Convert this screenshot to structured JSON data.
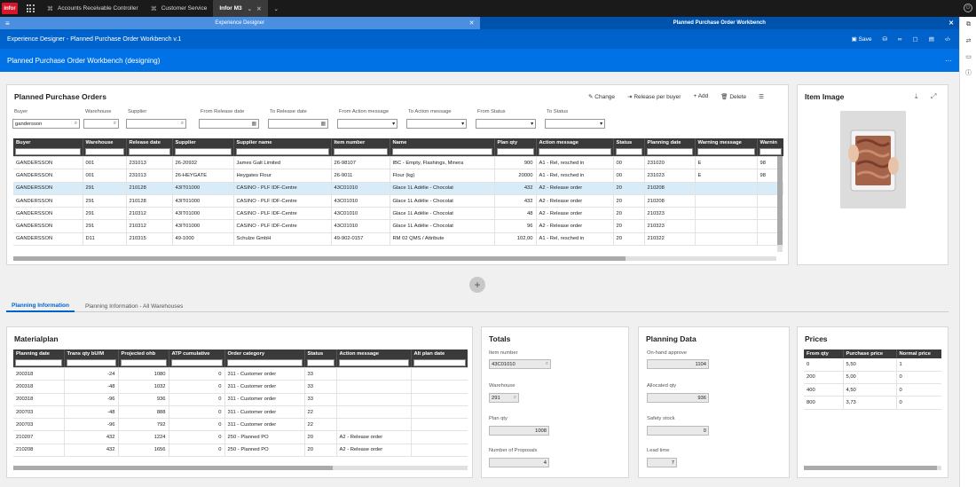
{
  "topbar": {
    "logo": "infor",
    "tabs": [
      {
        "label": "Accounts Receivable Controller"
      },
      {
        "label": "Customer Service"
      },
      {
        "label": "Infor M3"
      }
    ]
  },
  "bluebar": {
    "tabs": [
      {
        "label": "Experience Designer"
      },
      {
        "label": "Planned Purchase Order Workbench"
      }
    ]
  },
  "designbar": {
    "title": "Experience Designer - Planned Purchase Order Workbench v.1",
    "save_label": "Save"
  },
  "header": {
    "title": "Planned Purchase Order Workbench (designing)",
    "more": "···"
  },
  "ppo": {
    "title": "Planned Purchase Orders",
    "actions": [
      "Change",
      "Release per buyer",
      "Add",
      "Delete"
    ],
    "filters": [
      {
        "label": "Buyer",
        "value": "gandersson"
      },
      {
        "label": "Warehouse",
        "value": ""
      },
      {
        "label": "Supplier",
        "value": ""
      },
      {
        "label": "From Release date",
        "value": ""
      },
      {
        "label": "To Release date",
        "value": ""
      },
      {
        "label": "From Action message",
        "value": ""
      },
      {
        "label": "To Action message",
        "value": ""
      },
      {
        "label": "From Status",
        "value": ""
      },
      {
        "label": "To Status",
        "value": ""
      }
    ],
    "columns": [
      "Buyer",
      "Warehouse",
      "Release date",
      "Supplier",
      "Supplier name",
      "Item number",
      "Name",
      "Plan qty",
      "Action message",
      "Status",
      "Planning date",
      "Warning message",
      "Warnin"
    ],
    "rows": [
      [
        "GANDERSSON",
        "001",
        "231013",
        "26-20932",
        "James Galt Limited",
        "26-98107",
        "IBC - Empty, Flashings, Minera",
        "900",
        "A1 - Rel, resched in",
        "00",
        "231020",
        "E",
        "98"
      ],
      [
        "GANDERSSON",
        "001",
        "231013",
        "26-HEYGATE",
        "Heygates Flour",
        "26-9011",
        "Flour (kg)",
        "20000",
        "A1 - Rel, resched in",
        "00",
        "231023",
        "E",
        "98"
      ],
      [
        "GANDERSSON",
        "291",
        "210128",
        "43IT01000",
        "CASINO - PLF IDF-Centre",
        "43C01010",
        "Glace 1L Adélie - Chocolat",
        "432",
        "A2 - Release order",
        "20",
        "210208",
        "",
        ""
      ],
      [
        "GANDERSSON",
        "291",
        "210128",
        "43IT01000",
        "CASINO - PLF IDF-Centre",
        "43C01010",
        "Glace 1L Adélie - Chocolat",
        "432",
        "A2 - Release order",
        "20",
        "210208",
        "",
        ""
      ],
      [
        "GANDERSSON",
        "291",
        "210312",
        "43IT01000",
        "CASINO - PLF IDF-Centre",
        "43C01010",
        "Glace 1L Adélie - Chocolat",
        "48",
        "A2 - Release order",
        "20",
        "210323",
        "",
        ""
      ],
      [
        "GANDERSSON",
        "291",
        "210312",
        "43IT01000",
        "CASINO - PLF IDF-Centre",
        "43C01010",
        "Glace 1L Adélie - Chocolat",
        "96",
        "A2 - Release order",
        "20",
        "210323",
        "",
        ""
      ],
      [
        "GANDERSSON",
        "D11",
        "210315",
        "49-1000",
        "Schulze GmbH",
        "49-902-0157",
        "RM 02 QMS / Attribute",
        "102,00",
        "A1 - Rel, resched in",
        "20",
        "210322",
        "",
        ""
      ]
    ]
  },
  "item_image": {
    "title": "Item Image"
  },
  "tabs2": [
    {
      "label": "Planning Information"
    },
    {
      "label": "Planning Information - All Warehouses"
    }
  ],
  "materialplan": {
    "title": "Materialplan",
    "columns": [
      "Planning date",
      "Trans qty bU/M",
      "Projected ohb",
      "ATP cumulative",
      "Order category",
      "Status",
      "Action message",
      "Alt plan date"
    ],
    "rows": [
      [
        "200318",
        "-24",
        "1080",
        "0",
        "311 - Customer order",
        "33",
        "",
        ""
      ],
      [
        "200318",
        "-48",
        "1032",
        "0",
        "311 - Customer order",
        "33",
        "",
        ""
      ],
      [
        "200318",
        "-96",
        "936",
        "0",
        "311 - Customer order",
        "33",
        "",
        ""
      ],
      [
        "200703",
        "-48",
        "888",
        "0",
        "311 - Customer order",
        "22",
        "",
        ""
      ],
      [
        "200703",
        "-96",
        "792",
        "0",
        "311 - Customer order",
        "22",
        "",
        ""
      ],
      [
        "210207",
        "432",
        "1224",
        "0",
        "250 - Planned PO",
        "20",
        "A2 - Release order",
        ""
      ],
      [
        "210208",
        "432",
        "1656",
        "0",
        "250 - Planned PO",
        "20",
        "A2 - Release order",
        ""
      ]
    ]
  },
  "totals": {
    "title": "Totals",
    "fields": [
      {
        "label": "Item number",
        "value": "43C01010"
      },
      {
        "label": "Warehouse",
        "value": "291"
      },
      {
        "label": "Plan qty",
        "value": "1008"
      },
      {
        "label": "Number of Proposals",
        "value": "4"
      }
    ]
  },
  "planning_data": {
    "title": "Planning Data",
    "fields": [
      {
        "label": "On-hand approve",
        "value": "1104"
      },
      {
        "label": "Allocated qty",
        "value": "936"
      },
      {
        "label": "Safety stock",
        "value": "0"
      },
      {
        "label": "Lead time",
        "value": "7"
      }
    ]
  },
  "prices": {
    "title": "Prices",
    "columns": [
      "From qty",
      "Purchase price",
      "Normal price"
    ],
    "rows": [
      [
        "0",
        "5,50",
        "1"
      ],
      [
        "200",
        "5,00",
        "0"
      ],
      [
        "400",
        "4,50",
        "0"
      ],
      [
        "800",
        "3,73",
        "0"
      ]
    ]
  },
  "colors": {
    "brand": "#d8152a",
    "blue": "#0072e6",
    "selected_row": "#d7ecf8"
  }
}
